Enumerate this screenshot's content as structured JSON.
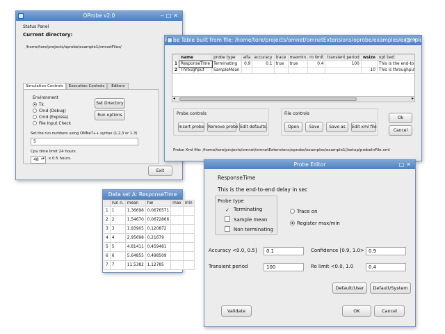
{
  "status_window": {
    "title": "OProbe v2.0",
    "status_panel_label": "Status Panel",
    "current_dir_label": "Current directory:",
    "current_dir_value": "/home/tore/projects/oprobe/example1/omnetFiles/",
    "tabs": [
      "Simulation Controls",
      "Execution Controls",
      "Editors"
    ],
    "environment_label": "Environment",
    "environment_options": [
      {
        "label": "Tk",
        "selected": true
      },
      {
        "label": "Cmd (Debug)",
        "selected": false
      },
      {
        "label": "Cmd (Express)",
        "selected": false
      },
      {
        "label": "File Input Check",
        "selected": false
      }
    ],
    "set_directory_button": "Set Directory",
    "run_options_button": "Run options",
    "run_numbers_label": "Set the run numbers using OMNeT++ syntax (1,2,3 or 1-3)",
    "run_numbers_value": "5",
    "cpu_time_label": "Cpu time limit 24 hours",
    "cpu_time_value": "48",
    "cpu_time_unit": "x 0.5 hours.",
    "exit_button": "Exit"
  },
  "probe_table_window": {
    "title": "Probe Table built from file: /home/tore/projects/omnet/omnetExtensions/oprobe/examples/example1//setup/probeInFile.xml",
    "columns": [
      "",
      "name",
      "probe type",
      "alfa",
      "accuracy",
      "trace",
      "maxmin",
      "ro limit",
      "transient period",
      "wsize",
      "opt text"
    ],
    "rows": [
      [
        "1",
        "ResponseTime",
        "Terminating",
        "0.9",
        "0.1",
        "true",
        "true",
        "0.4",
        "100",
        "",
        "This is the end-to-end dela"
      ],
      [
        "2",
        "Throughput",
        "SampleMean",
        "",
        "",
        "",
        "",
        "",
        "",
        "10",
        "This is throughput in packet"
      ]
    ],
    "probe_controls_label": "Probe controls",
    "probe_buttons": [
      "Insert probe",
      "Remove probe",
      "Edit defaults"
    ],
    "file_controls_label": "File controls",
    "file_buttons": [
      "Open",
      "Save",
      "Save as",
      "Edit xml file"
    ],
    "ok_button": "Ok",
    "cancel_button": "Cancel",
    "xml_file_label": "Probe Xml file: /home/tore/projects/omnet/omnetExtensions/oprobe/examples/example1//setup/probeInFile.xml"
  },
  "dataset_window": {
    "title": "Data set A: ResponseTime",
    "columns": [
      "",
      "run n.",
      "mean",
      "hw",
      "max",
      "min"
    ],
    "rows": [
      [
        "1",
        "1",
        "1.36698",
        "0.0676571",
        "",
        ""
      ],
      [
        "2",
        "2",
        "1.54670",
        "0.0672866",
        "",
        ""
      ],
      [
        "3",
        "3",
        "1.93905",
        "0.120872",
        "",
        ""
      ],
      [
        "4",
        "4",
        "2.95698",
        "0.21679",
        "",
        ""
      ],
      [
        "5",
        "5",
        "4.81411",
        "0.459481",
        "",
        ""
      ],
      [
        "6",
        "6",
        "5.64855",
        "0.498509",
        "",
        ""
      ],
      [
        "7",
        "7",
        "11.5382",
        "1.12785",
        "",
        ""
      ]
    ]
  },
  "probe_editor": {
    "title": "Probe Editor",
    "name": "ResponseTime",
    "description": "This is the end-to-end delay in sec",
    "probe_type_label": "Probe type",
    "probe_types": [
      {
        "label": "Terminating",
        "checked": true
      },
      {
        "label": "Sample mean",
        "checked": false
      },
      {
        "label": "Non terminating",
        "checked": false
      }
    ],
    "trace_on_label": "Trace on",
    "register_label": "Register max/min",
    "accuracy_label": "Accuracy <0.0, 0.5]",
    "accuracy_value": "0.1",
    "confidence_label": "Confidence [0.9, 1.0>",
    "confidence_value": "0.9",
    "transient_label": "Transient period",
    "transient_value": "100",
    "ro_limit_label": "Ro limit <0.0, 1.0",
    "ro_limit_value": "0.4",
    "default_user_button": "Default/User",
    "default_system_button": "Default/System",
    "validate_button": "Validate",
    "ok_button": "OK",
    "cancel_button": "Cancel"
  }
}
